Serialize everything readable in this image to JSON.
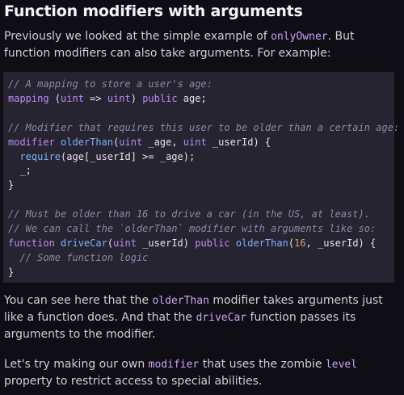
{
  "heading": "Function modifiers with arguments",
  "intro": {
    "before": "Previously we looked at the simple example of ",
    "code": "onlyOwner",
    "after": ". But function modifiers can also take arguments. For example:"
  },
  "code_lines": [
    "// A mapping to store a user's age:",
    "mapping (uint => uint) public age;",
    "",
    "// Modifier that requires this user to be older than a certain age:",
    "modifier olderThan(uint _age, uint _userId) {",
    "  require(age[_userId] >= _age);",
    "  _;",
    "}",
    "",
    "// Must be older than 16 to drive a car (in the US, at least).",
    "// We can call the `olderThan` modifier with arguments like so:",
    "function driveCar(uint _userId) public olderThan(16, _userId) {",
    "  // Some function logic",
    "}"
  ],
  "para2": {
    "t1": "You can see here that the ",
    "c1": "olderThan",
    "t2": " modifier takes arguments just like a function does. And that the ",
    "c2": "driveCar",
    "t3": " function passes its arguments to the modifier."
  },
  "para3": {
    "t1": "Let's try making our own ",
    "c1": "modifier",
    "t2": " that uses the zombie ",
    "c2": "level",
    "t3": " property to restrict access to special abilities."
  }
}
